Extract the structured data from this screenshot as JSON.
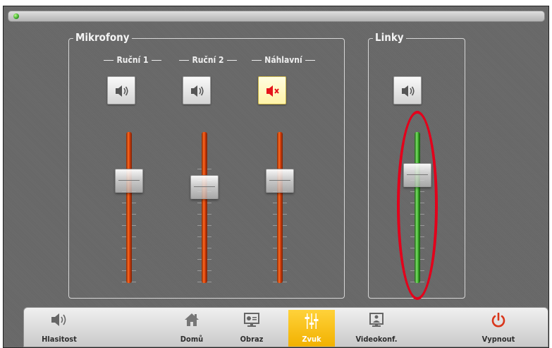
{
  "window": {
    "status_led": "green"
  },
  "groups": {
    "microphones": {
      "title": "Mikrofony",
      "channels": [
        {
          "label": "Ruční 1",
          "muted": false,
          "level": 0.82
        },
        {
          "label": "Ruční 2",
          "muted": false,
          "level": 0.78
        },
        {
          "label": "Náhlavní",
          "muted": true,
          "level": 0.82
        }
      ]
    },
    "lines": {
      "title": "Linky",
      "channels": [
        {
          "label": "",
          "muted": false,
          "level": 0.86
        }
      ]
    }
  },
  "nav": {
    "volume": "Hlasitost",
    "home": "Domů",
    "image": "Obraz",
    "sound": "Zvuk",
    "videoconf": "Videokonf.",
    "power": "Vypnout"
  },
  "colors": {
    "accent": "#f2b100",
    "mic_fader": "#e0470f",
    "line_fader": "#3fb32c",
    "highlight": "#e3001b"
  },
  "icons": [
    "speaker-icon",
    "speaker-muted-icon",
    "home-icon",
    "display-icon",
    "mixer-icon",
    "videoconference-icon",
    "power-icon"
  ]
}
